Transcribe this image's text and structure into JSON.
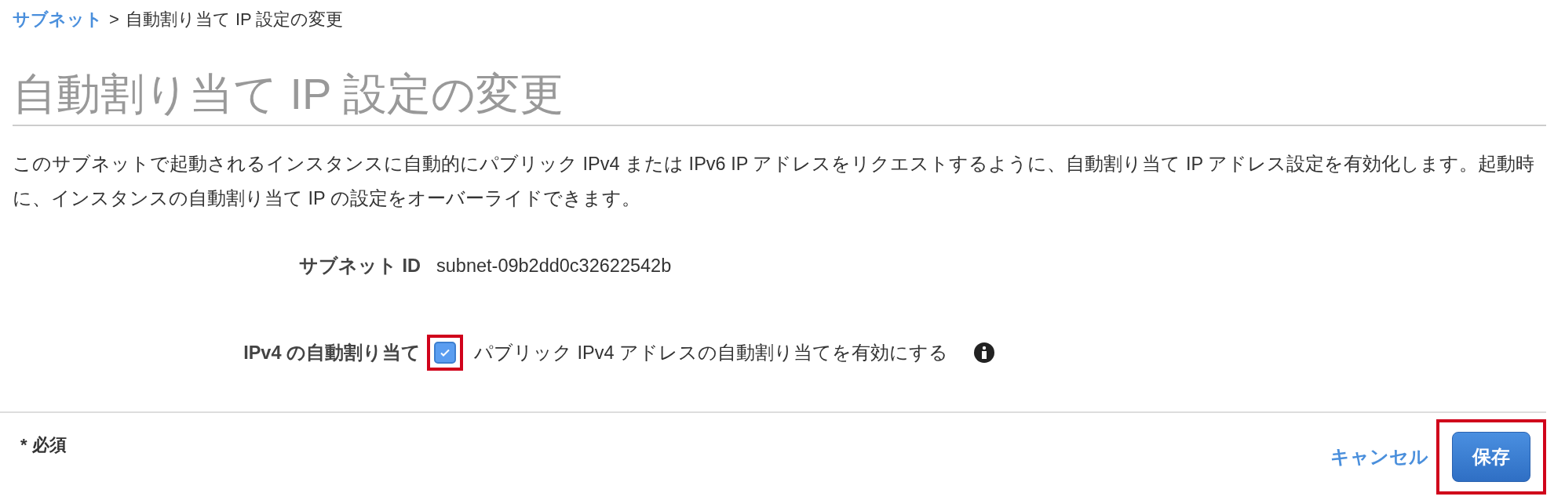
{
  "breadcrumb": {
    "link": "サブネット",
    "separator": ">",
    "current": "自動割り当て IP 設定の変更"
  },
  "title": "自動割り当て IP 設定の変更",
  "description": "このサブネットで起動されるインスタンスに自動的にパブリック IPv4 または IPv6 IP アドレスをリクエストするように、自動割り当て IP アドレス設定を有効化します。起動時に、インスタンスの自動割り当て IP の設定をオーバーライドできます。",
  "fields": [
    {
      "kind": "text",
      "label": "サブネット ID",
      "value": "subnet-09b2dd0c32622542b"
    },
    {
      "kind": "checkbox",
      "label": "IPv4 の自動割り当て",
      "option": "パブリック IPv4 アドレスの自動割り当てを有効にする",
      "checked": true,
      "highlighted": true,
      "info": true
    }
  ],
  "footer": {
    "required_note": "* 必須",
    "cancel": "キャンセル",
    "save": {
      "label": "保存",
      "highlighted": true
    }
  }
}
